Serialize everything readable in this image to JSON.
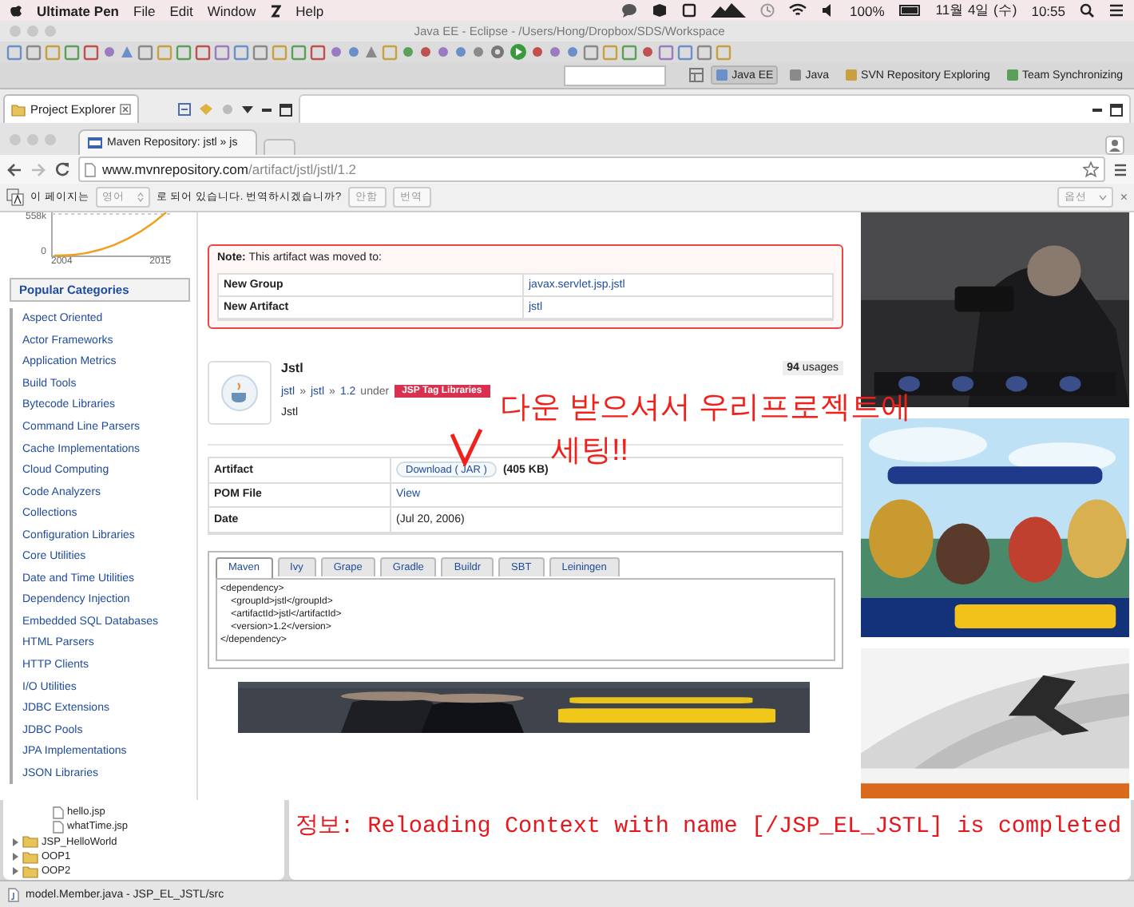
{
  "menubar": {
    "app": "Ultimate Pen",
    "menus": [
      "File",
      "Edit",
      "Window",
      "Help"
    ],
    "battery": "100%",
    "date": "11월 4일 (수)",
    "time": "10:55"
  },
  "eclipse": {
    "title": "Java EE - Eclipse - /Users/Hong/Dropbox/SDS/Workspace",
    "view_tab": "Project Explorer",
    "perspectives": [
      {
        "label": "Java EE",
        "selected": true
      },
      {
        "label": "Java",
        "selected": false
      },
      {
        "label": "SVN Repository Exploring",
        "selected": false
      },
      {
        "label": "Team Synchronizing",
        "selected": false
      }
    ]
  },
  "browser": {
    "tab": "Maven Repository: jstl » js",
    "url_host": "www.mvnrepository.com",
    "url_path": "/artifact/jstl/jstl/1.2",
    "translate": {
      "prefix": "이 페이지는",
      "language": "영어",
      "question": "로 되어 있습니다. 번역하시겠습니까?",
      "buttons": [
        "안함",
        "번역"
      ],
      "options": "옵션",
      "close": "×"
    }
  },
  "sidebar": {
    "trend_labels": {
      "top": "558k",
      "zero": "0",
      "start": "2004",
      "end": "2015"
    },
    "title": "Popular Categories",
    "categories": [
      "Aspect Oriented",
      "Actor Frameworks",
      "Application Metrics",
      "Build Tools",
      "Bytecode Libraries",
      "Command Line Parsers",
      "Cache Implementations",
      "Cloud Computing",
      "Code Analyzers",
      "Collections",
      "Configuration Libraries",
      "Core Utilities",
      "Date and Time Utilities",
      "Dependency Injection",
      "Embedded SQL Databases",
      "HTML Parsers",
      "HTTP Clients",
      "I/O Utilities",
      "JDBC Extensions",
      "JDBC Pools",
      "JPA Implementations",
      "JSON Libraries"
    ]
  },
  "note": {
    "text": "**Note:** This artifact was moved to:",
    "rows": [
      {
        "key": "New Group",
        "value": "javax.servlet.jsp.jstl"
      },
      {
        "key": "New Artifact",
        "value": "jstl"
      }
    ]
  },
  "artifact": {
    "name": "Jstl",
    "crumbs": [
      "jstl",
      "jstl",
      "1.2"
    ],
    "separator": "»",
    "under": "under",
    "tag": "JSP Tag Libraries",
    "description": "Jstl",
    "usages_count": "94",
    "usages_label": "usages"
  },
  "details": [
    {
      "key": "Artifact",
      "kind": "download",
      "button": "Download ( JAR )",
      "size": "(405 KB)"
    },
    {
      "key": "POM File",
      "kind": "link",
      "value": "View"
    },
    {
      "key": "Date",
      "kind": "text",
      "value": "(Jul 20, 2006)"
    }
  ],
  "build_tabs": [
    {
      "label": "Maven",
      "selected": true
    },
    {
      "label": "Ivy",
      "selected": false
    },
    {
      "label": "Grape",
      "selected": false
    },
    {
      "label": "Gradle",
      "selected": false
    },
    {
      "label": "Buildr",
      "selected": false
    },
    {
      "label": "SBT",
      "selected": false
    },
    {
      "label": "Leiningen",
      "selected": false
    }
  ],
  "snippet": "<dependency>\n\t<groupId>jstl</groupId>\n\t<artifactId>jstl</artifactId>\n\t<version>1.2</version>\n</dependency>",
  "annotation": {
    "lines": [
      "다운 받으셔서 우리프로젝트에",
      "세팅!!"
    ]
  },
  "tree": [
    {
      "children": [
        {
          "label": "hello.jsp"
        },
        {
          "label": "whatTime.jsp"
        }
      ]
    },
    {
      "label": "JSP_HelloWorld",
      "expanded": false
    },
    {
      "label": "OOP1",
      "expanded": false
    },
    {
      "label": "OOP2",
      "expanded": false
    }
  ],
  "console": [
    "정보: Reloading Context with name [/JSP_EL_JSTL] is completed"
  ],
  "status": "model.Member.java - JSP_EL_JSTL/src"
}
